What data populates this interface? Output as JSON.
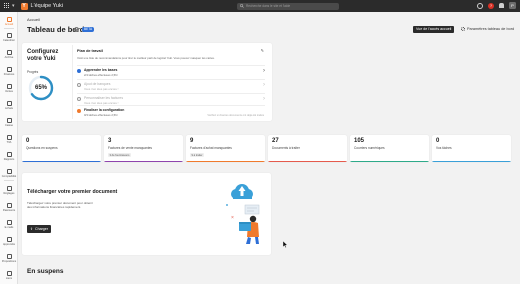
{
  "topbar": {
    "app_title": "L'équipe Yuki",
    "logo_letter": "Y",
    "search_placeholder": "Recherche dans le site et l'aide",
    "avatar_initials": "P"
  },
  "sidebar": {
    "items": [
      {
        "label": "Accueil",
        "icon": "home-icon"
      },
      {
        "label": "Calendrier",
        "icon": "calendar-icon"
      },
      {
        "label": "Archive",
        "icon": "archive-icon"
      },
      {
        "label": "Finances",
        "icon": "finance-icon"
      },
      {
        "label": "Ventes",
        "icon": "sales-icon"
      },
      {
        "label": "Achats",
        "icon": "purchases-icon"
      },
      {
        "label": "Caisse",
        "icon": "cash-icon"
      },
      {
        "label": "TVA",
        "icon": "tax-icon"
      },
      {
        "label": "Rapports",
        "icon": "reports-icon"
      },
      {
        "label": "Comptabilité",
        "icon": "accounting-icon"
      },
      {
        "label": "Réglages",
        "icon": "settings-icon"
      },
      {
        "label": "Paiements",
        "icon": "payments-icon"
      },
      {
        "label": "E-mails",
        "icon": "mail-icon"
      },
      {
        "label": "Apprendre",
        "icon": "learn-icon"
      },
      {
        "label": "Propositions",
        "icon": "ideas-icon"
      },
      {
        "label": "Liens",
        "icon": "links-icon"
      }
    ]
  },
  "header": {
    "breadcrumb": "Accueil",
    "title": "Tableau de bord",
    "badge": "BETA",
    "view_button": "Vue de l'accès accueil",
    "params_button": "Paramètres tableau de bord"
  },
  "configure": {
    "title": "Configurez votre Yuki",
    "progress_label": "Progrès",
    "progress_value": "65%",
    "progress_fraction": 0.65,
    "inner_title": "Plan de travail",
    "inner_sub": "Voici une liste de recommandations pour tirer le meilleur parti de logiciel Yuki. Vous pouvez masquer les cartes.",
    "steps": [
      {
        "title": "Apprendre les bases",
        "sub": "2/4 tâches effectuées 2,5hr",
        "state": "done"
      },
      {
        "title": "Ajout de banques",
        "sub": "Vous n'en êtes pas encore !",
        "state": "dim"
      },
      {
        "title": "Personnaliser les factures",
        "sub": "Vous n'en êtes pas encore !",
        "state": "dim"
      },
      {
        "title": "Finaliser la configuration",
        "sub": "0/3 tâches effectuées 2,5hr",
        "state": "active"
      }
    ],
    "footer": "Vérifiez si d'autres documents ont déjà été traités"
  },
  "stats": [
    {
      "value": "0",
      "label": "Questions en suspens",
      "chip": "",
      "color": "#2e6fd6"
    },
    {
      "value": "3",
      "label": "Factures de vente manquantes",
      "chip": "3 de fournisseurs",
      "color": "#8e44ad"
    },
    {
      "value": "9",
      "label": "Factures d'achat manquantes",
      "chip": "9 à traiter",
      "color": "#f07a2d"
    },
    {
      "value": "27",
      "label": "Documents à traiter",
      "chip": "",
      "color": "#e55b4d"
    },
    {
      "value": "105",
      "label": "Courriers numériques",
      "chip": "",
      "color": "#2eaa8a"
    },
    {
      "value": "0",
      "label": "Vos tâches",
      "chip": "",
      "color": "#3aa0d8"
    }
  ],
  "upload": {
    "title": "Télécharger votre premier document",
    "desc": "Téléchargez votre premier document pour obtenir des informations financières rapidement.",
    "button": "Charger"
  },
  "section": {
    "title": "En suspens"
  }
}
